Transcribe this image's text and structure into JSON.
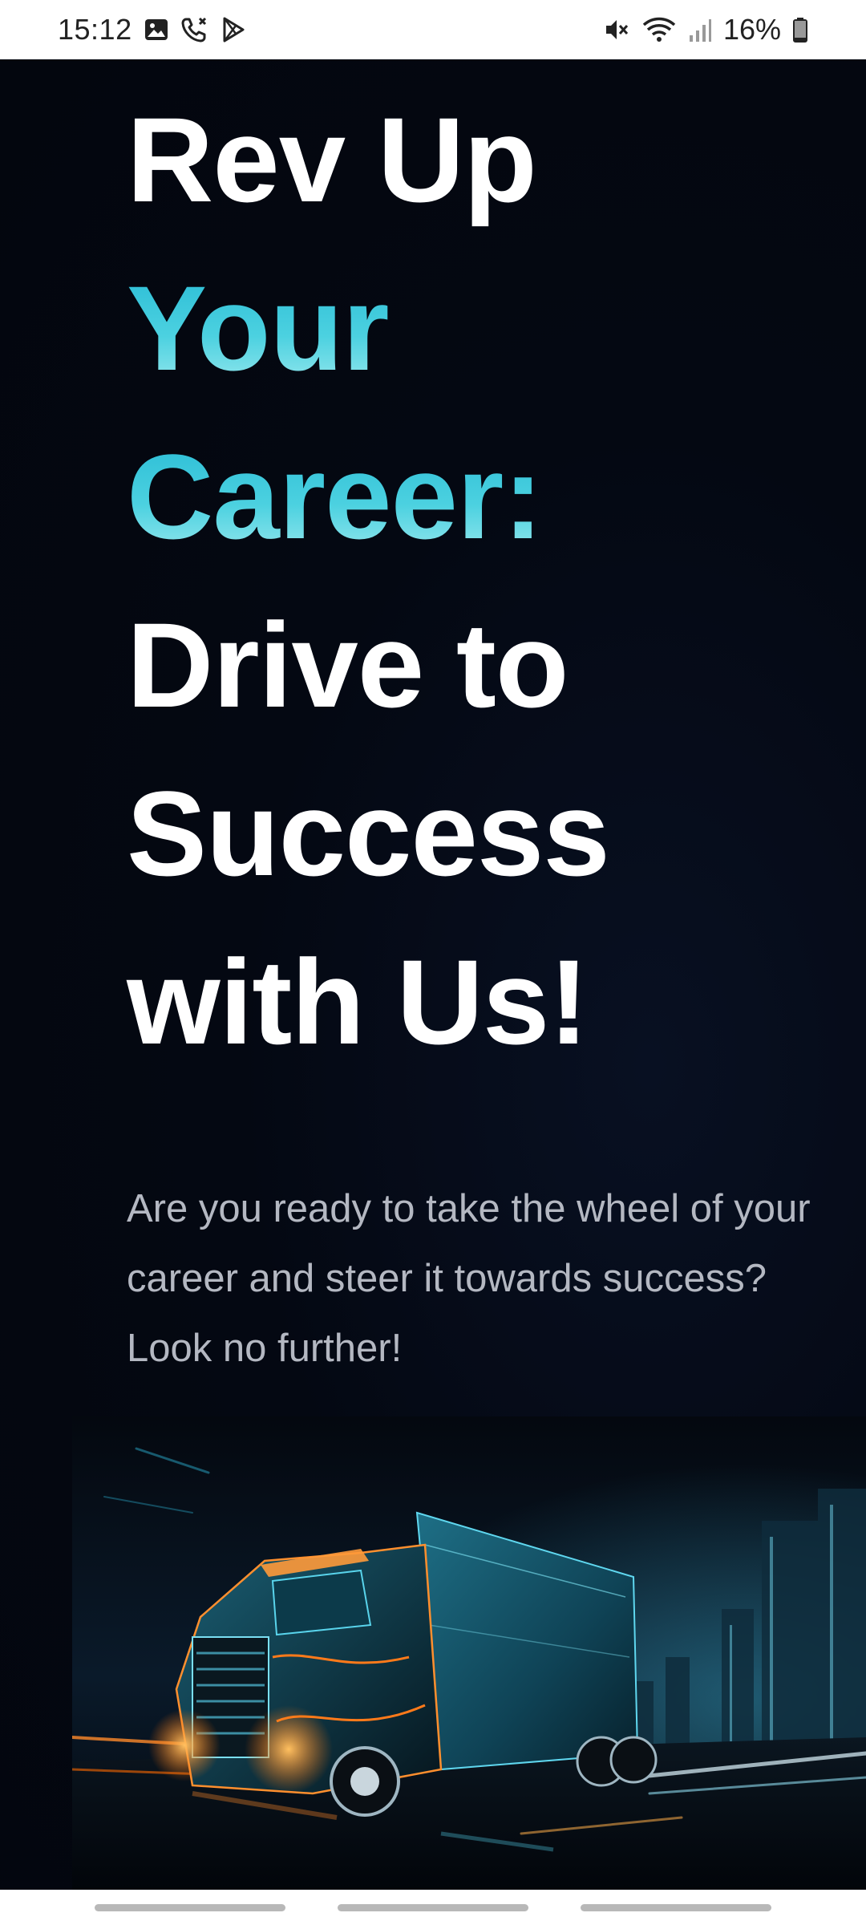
{
  "status_bar": {
    "time": "15:12",
    "battery": "16%",
    "left_icons": [
      "gallery-icon",
      "missed-call-icon",
      "play-store-icon"
    ],
    "right_icons": [
      "mute-icon",
      "wifi-icon",
      "signal-icon",
      "battery-icon"
    ]
  },
  "hero": {
    "headline": {
      "line1": "Rev Up",
      "line2": "Your",
      "line3": "Career:",
      "line4": "Drive to",
      "line5": "Success",
      "line6": "with Us!"
    },
    "accent_color": "#3cc6dc",
    "subtext": "Are you ready to take the wheel of your career and steer it towards success? Look no further!"
  },
  "image": {
    "icon": "truck-illustration"
  },
  "colors": {
    "background": "#03060e",
    "headline": "#ffffff",
    "subtext": "#b4b8c2"
  }
}
